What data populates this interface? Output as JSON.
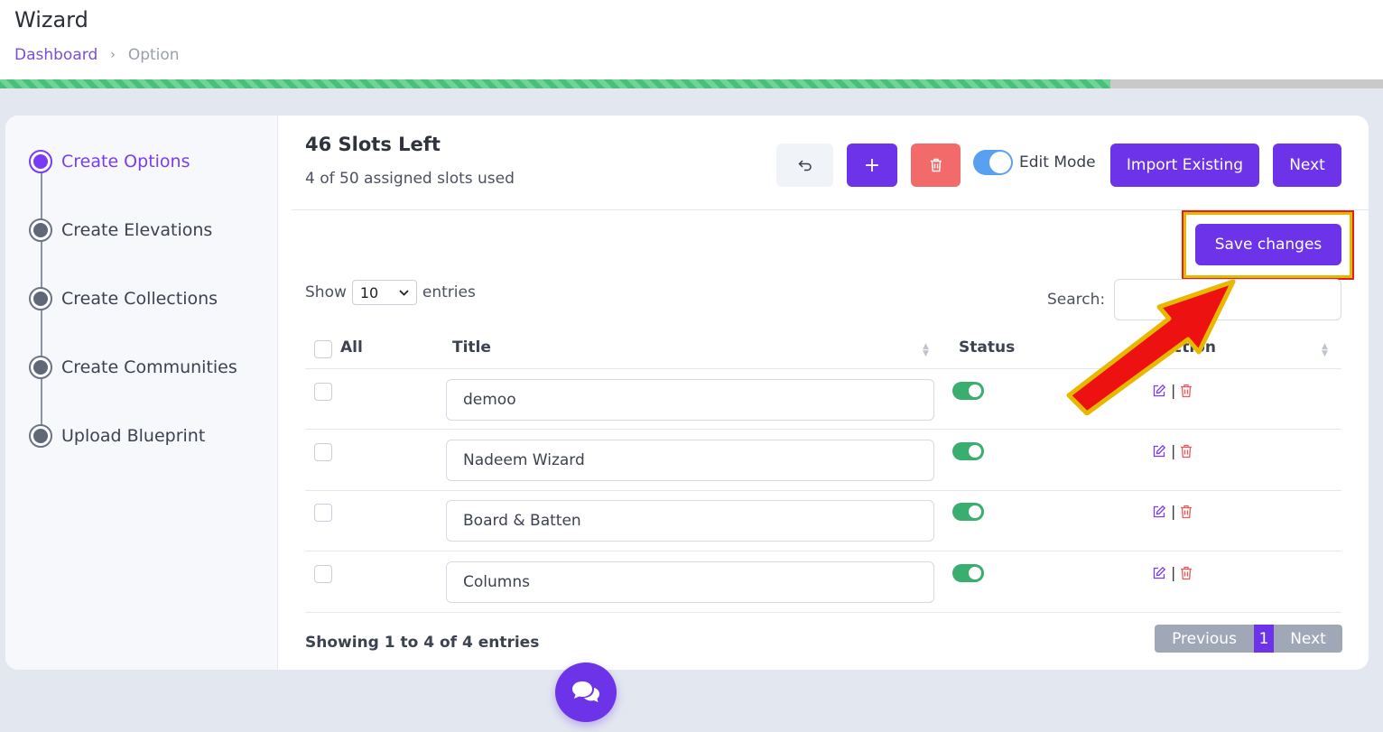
{
  "header": {
    "title": "Wizard",
    "breadcrumb": {
      "home": "Dashboard",
      "separator": "›",
      "current": "Option"
    },
    "progress_fraction": 0.803
  },
  "sidebar": {
    "steps": [
      {
        "label": "Create Options",
        "active": true
      },
      {
        "label": "Create Elevations",
        "active": false
      },
      {
        "label": "Create Collections",
        "active": false
      },
      {
        "label": "Create Communities",
        "active": false
      },
      {
        "label": "Upload Blueprint",
        "active": false
      }
    ]
  },
  "main": {
    "slots_title": "46 Slots Left",
    "slots_sub": "4 of 50 assigned slots used",
    "toolbar": {
      "undo_icon": "undo-icon",
      "add_label": "+",
      "delete_icon": "trash-icon",
      "edit_mode_label": "Edit Mode",
      "edit_mode_on": true,
      "import_label": "Import Existing",
      "next_label": "Next"
    },
    "save_label": "Save changes",
    "show": {
      "prefix": "Show",
      "value": "10",
      "suffix": "entries"
    },
    "search": {
      "label": "Search:",
      "value": ""
    },
    "table": {
      "headers": {
        "all": "All",
        "title": "Title",
        "status": "Status",
        "action": "Action"
      },
      "rows": [
        {
          "title": "demoo",
          "status": true
        },
        {
          "title": "Nadeem Wizard",
          "status": true
        },
        {
          "title": "Board & Batten",
          "status": true
        },
        {
          "title": "Columns",
          "status": true
        }
      ]
    },
    "showing_text": "Showing 1 to 4 of 4 entries",
    "pager": {
      "previous": "Previous",
      "current": "1",
      "next": "Next"
    }
  },
  "colors": {
    "accent": "#6d33e8",
    "danger": "#f26a6a",
    "success": "#3aae6e",
    "annotation_arrow": "#ee1111",
    "annotation_outline": "#e6b800"
  },
  "chat_icon": "chat-bubbles-icon"
}
